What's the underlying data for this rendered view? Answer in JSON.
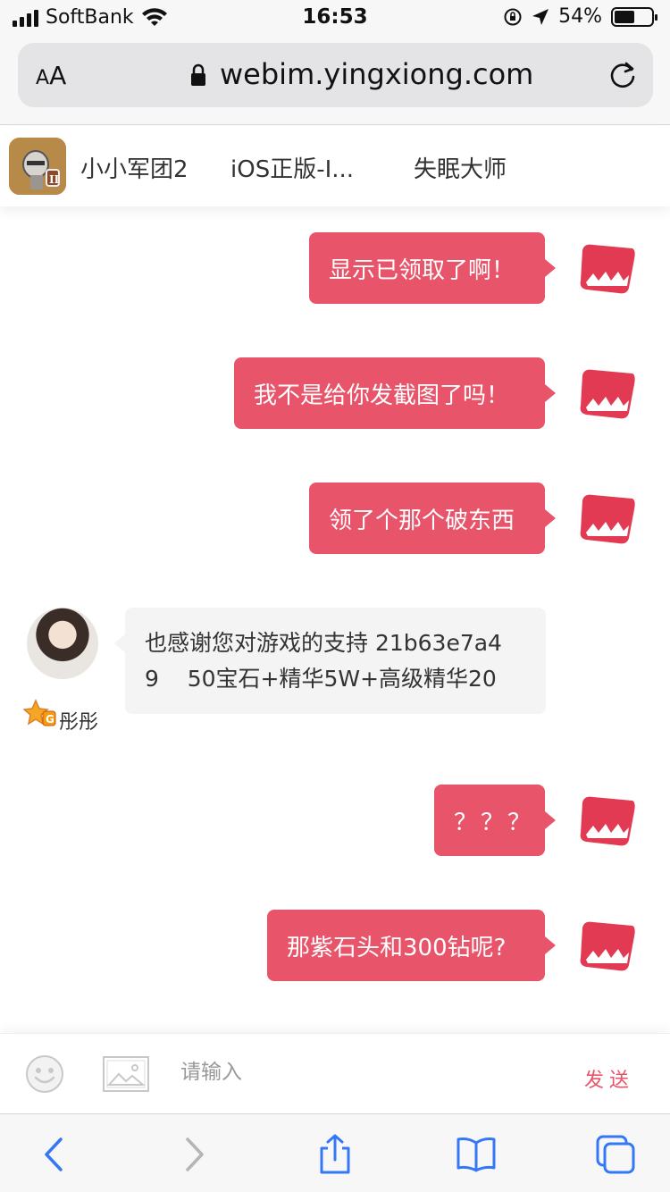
{
  "status_bar": {
    "carrier": "SoftBank",
    "time": "16:53",
    "battery_percent": "54%",
    "battery_level": 0.54
  },
  "browser": {
    "text_size_label_small": "A",
    "text_size_label_large": "A",
    "url": "webim.yingxiong.com"
  },
  "header": {
    "tabs": [
      {
        "label": "小小军团2"
      },
      {
        "label": "iOS正版-I..."
      },
      {
        "label": "失眠大师"
      }
    ]
  },
  "messages": [
    {
      "side": "right",
      "text": "显示已领取了啊！"
    },
    {
      "side": "right",
      "text": "我不是给你发截图了吗！"
    },
    {
      "side": "right",
      "text": "领了个那个破东西"
    },
    {
      "side": "left",
      "sender": "彤彤",
      "line1": "也感谢您对游戏的支持 21b63e7a4",
      "line2": "9    50宝石+精华5W+高级精华20"
    },
    {
      "side": "right",
      "text": "？？？"
    },
    {
      "side": "right",
      "text": "那紫石头和300钻呢?"
    }
  ],
  "input_bar": {
    "placeholder": "请输入",
    "send_label": "发送"
  },
  "colors": {
    "accent": "#e8546a",
    "bubble_left": "#f4f4f4",
    "ios_blue": "#3478f6"
  }
}
